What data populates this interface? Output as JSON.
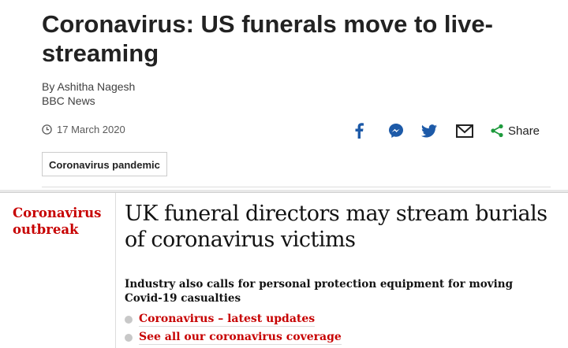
{
  "bbc": {
    "headline_line1": "Coronavirus: US funerals move to live-",
    "headline_line2": "streaming",
    "byline": "By Ashitha Nagesh",
    "source": "BBC News",
    "date": "17 March 2020",
    "share_label": "Share",
    "topic_tag": "Coronavirus pandemic",
    "icons": [
      "clock-icon",
      "facebook-icon",
      "messenger-icon",
      "twitter-icon",
      "email-icon",
      "share-icon"
    ],
    "icon_color": "#1d5aa8"
  },
  "guardian": {
    "kicker_line1": "Coronavirus",
    "kicker_line2": "outbreak",
    "headline_line1": "UK funeral directors may stream burials",
    "headline_line2": "of coronavirus victims",
    "standfirst_line1": "Industry also calls for personal protection equipment for moving",
    "standfirst_line2": "Covid-19 casualties",
    "links": [
      {
        "label": "Coronavirus – latest updates"
      },
      {
        "label": "See all our coronavirus coverage"
      }
    ],
    "accent_color": "#c70000"
  }
}
